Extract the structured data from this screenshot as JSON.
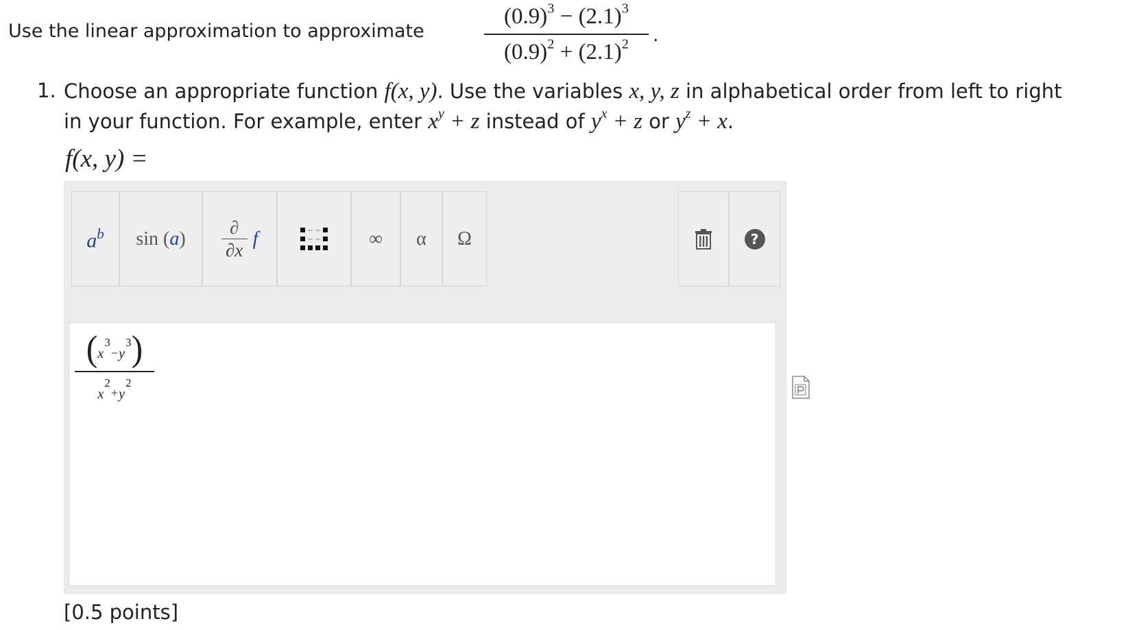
{
  "question": {
    "prompt": "Use the linear approximation to approximate",
    "expression": {
      "numerator": {
        "a": "(0.9)",
        "a_exp": "3",
        "op": " − ",
        "b": "(2.1)",
        "b_exp": "3"
      },
      "denominator": {
        "a": "(0.9)",
        "a_exp": "2",
        "op": " + ",
        "b": "(2.1)",
        "b_exp": "2"
      },
      "trailing": "."
    }
  },
  "step1": {
    "number": "1.",
    "text_1": "Choose an appropriate function ",
    "func": "f(x, y)",
    "text_2": ". Use the variables ",
    "vars": "x, y, z",
    "text_3": " in alphabetical order from left to right",
    "text_4": "in your function. For example, enter ",
    "ex1_base": "x",
    "ex1_exp": "y",
    "ex1_rest": " + z",
    "text_5": " instead of ",
    "ex2_base": "y",
    "ex2_exp": "x",
    "ex2_rest": " + z",
    "text_6": " or ",
    "ex3_base": "y",
    "ex3_exp": "z",
    "ex3_rest": " + x",
    "text_7": ".",
    "answer_label": "f(x, y) ="
  },
  "toolbar": {
    "power": {
      "base": "a",
      "exp": "b",
      "icon": "power-icon"
    },
    "sin": {
      "fn": "sin",
      "arg": "a",
      "icon": "sin-icon"
    },
    "derivative": {
      "top": "∂",
      "bottom": "∂x",
      "f": "f",
      "icon": "derivative-icon"
    },
    "matrix": {
      "icon": "matrix-icon"
    },
    "infinity": "∞",
    "alpha": "α",
    "omega": "Ω",
    "trash": {
      "icon": "trash-icon"
    },
    "help": "?"
  },
  "answer": {
    "numerator": {
      "x": "x",
      "x_exp": "3",
      "minus": "−",
      "y": "y",
      "y_exp": "3",
      "lparen": "(",
      "rparen": ")"
    },
    "denominator": {
      "x": "x",
      "x_exp": "2",
      "plus": "+",
      "y": "y",
      "y_exp": "2"
    }
  },
  "preview_icon": "document-preview-icon",
  "points": "[0.5 points]"
}
